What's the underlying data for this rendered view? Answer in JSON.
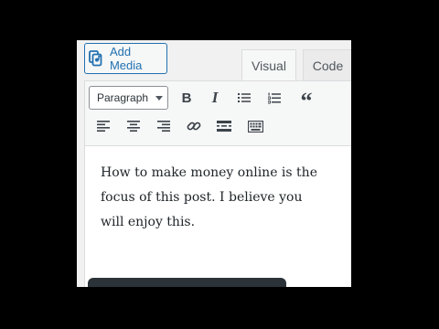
{
  "media": {
    "label": "Add Media",
    "icon": "add-media-icon"
  },
  "tabs": {
    "visual": "Visual",
    "code": "Code",
    "active": "visual"
  },
  "toolbar": {
    "format": {
      "selected": "Paragraph",
      "icon": "chevron-down-icon"
    },
    "bold": {
      "glyph": "B",
      "icon": "bold-icon"
    },
    "italic": {
      "glyph": "I",
      "icon": "italic-icon"
    },
    "bullet_list": {
      "icon": "bulleted-list-icon"
    },
    "numbered_list": {
      "icon": "numbered-list-icon"
    },
    "blockquote": {
      "glyph": "“",
      "icon": "blockquote-icon"
    },
    "align_left": {
      "icon": "align-left-icon"
    },
    "align_center": {
      "icon": "align-center-icon"
    },
    "align_right": {
      "icon": "align-right-icon"
    },
    "link": {
      "icon": "link-icon"
    },
    "read_more": {
      "icon": "read-more-icon"
    },
    "toolbar_toggle": {
      "icon": "keyboard-icon"
    }
  },
  "editor": {
    "content": "How to make money online is the focus of this post. I believe you will enjoy this."
  },
  "colors": {
    "accent": "#2271b1",
    "toolbar_bg": "#f6f7f7",
    "border": "#dcdcde",
    "text": "#1d2327"
  }
}
